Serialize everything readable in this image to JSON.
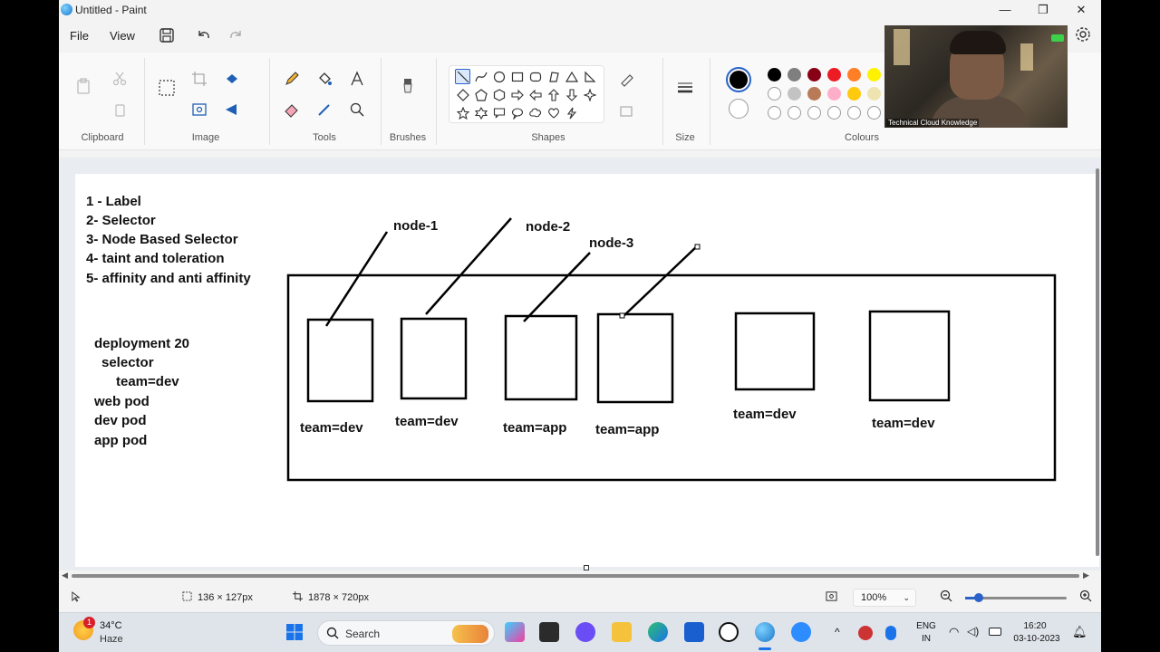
{
  "window": {
    "title": "Untitled - Paint",
    "minimize": "—",
    "maximize": "❐",
    "close": "✕"
  },
  "menu": {
    "file": "File",
    "view": "View"
  },
  "ribbon": {
    "groups": {
      "clipboard": "Clipboard",
      "image": "Image",
      "tools": "Tools",
      "brushes": "Brushes",
      "shapes": "Shapes",
      "size": "Size",
      "colours": "Colours"
    }
  },
  "palette": {
    "selected_colour_1": "#000000",
    "selected_colour_2": "#ffffff",
    "row1": [
      "#000000",
      "#7f7f7f",
      "#880015",
      "#ed1c24",
      "#ff7f27",
      "#fff200"
    ],
    "row2": [
      "",
      "#c3c3c3",
      "#b97a57",
      "#ffaec9",
      "#ffc90e",
      "#efe4b0"
    ],
    "row3": [
      "",
      "",
      "",
      "",
      "",
      ""
    ]
  },
  "webcam": {
    "caption": "Technical Cloud Knowledge"
  },
  "canvas": {
    "notes": [
      "1 - Label",
      "2- Selector",
      "3- Node Based Selector",
      "4- taint and toleration",
      "5- affinity and anti affinity"
    ],
    "notes2": [
      "deployment  20",
      "selector",
      "team=dev",
      "web pod",
      "dev pod",
      "app pod"
    ],
    "node_labels": [
      "node-1",
      "node-2",
      "node-3"
    ],
    "pod_labels": [
      "team=dev",
      "team=dev",
      "team=app",
      "team=app",
      "team=dev",
      "team=dev"
    ]
  },
  "statusbar": {
    "selection_size": "136 × 127px",
    "canvas_size": "1878 × 720px",
    "zoom": "100%",
    "zoom_level": 0.13
  },
  "taskbar": {
    "weather_temp": "34°C",
    "weather_desc": "Haze",
    "weather_badge": "1",
    "search_placeholder": "Search",
    "lang_top": "ENG",
    "lang_bottom": "IN",
    "time": "16:20",
    "date": "03-10-2023"
  }
}
